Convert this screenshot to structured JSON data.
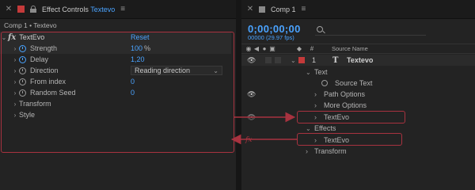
{
  "effect_controls": {
    "tab": {
      "title": "Effect Controls",
      "layer_name": "Textevo",
      "menu_icon": "hamburger-menu-icon"
    },
    "header": "Comp 1 • Textevo",
    "effect": {
      "fx_icon": "fx",
      "name": "TextEvo",
      "reset_label": "Reset",
      "properties": [
        {
          "label": "Strength",
          "value": "100",
          "unit": "%",
          "stopwatch": true
        },
        {
          "label": "Delay",
          "value": "1,20",
          "stopwatch": true
        },
        {
          "label": "Direction",
          "value": "Reading direction",
          "stopwatch": false
        },
        {
          "label": "From index",
          "value": "0",
          "stopwatch": false
        },
        {
          "label": "Random Seed",
          "value": "0",
          "stopwatch": false
        }
      ],
      "groups": [
        "Transform",
        "Style"
      ]
    }
  },
  "timeline": {
    "tab": {
      "title": "Comp 1",
      "menu_icon": "hamburger-menu-icon"
    },
    "timecode": "0;00;00;00",
    "fps_readout": "00000 (29.97 fps)",
    "search": {
      "placeholder": ""
    },
    "columns": {
      "source_name": "Source Name"
    },
    "layer": {
      "number": "1",
      "type_icon": "T",
      "name": "Textevo"
    },
    "tree": {
      "text": "Text",
      "source_text": "Source Text",
      "path_options": "Path Options",
      "more_options": "More Options",
      "animator": "TextEvo",
      "effects": "Effects",
      "effect": "TextEvo",
      "transform": "Transform"
    }
  },
  "colors": {
    "accent": "#4aa3ff",
    "highlight": "#a8323f",
    "layer_label": "#c43a3a"
  }
}
